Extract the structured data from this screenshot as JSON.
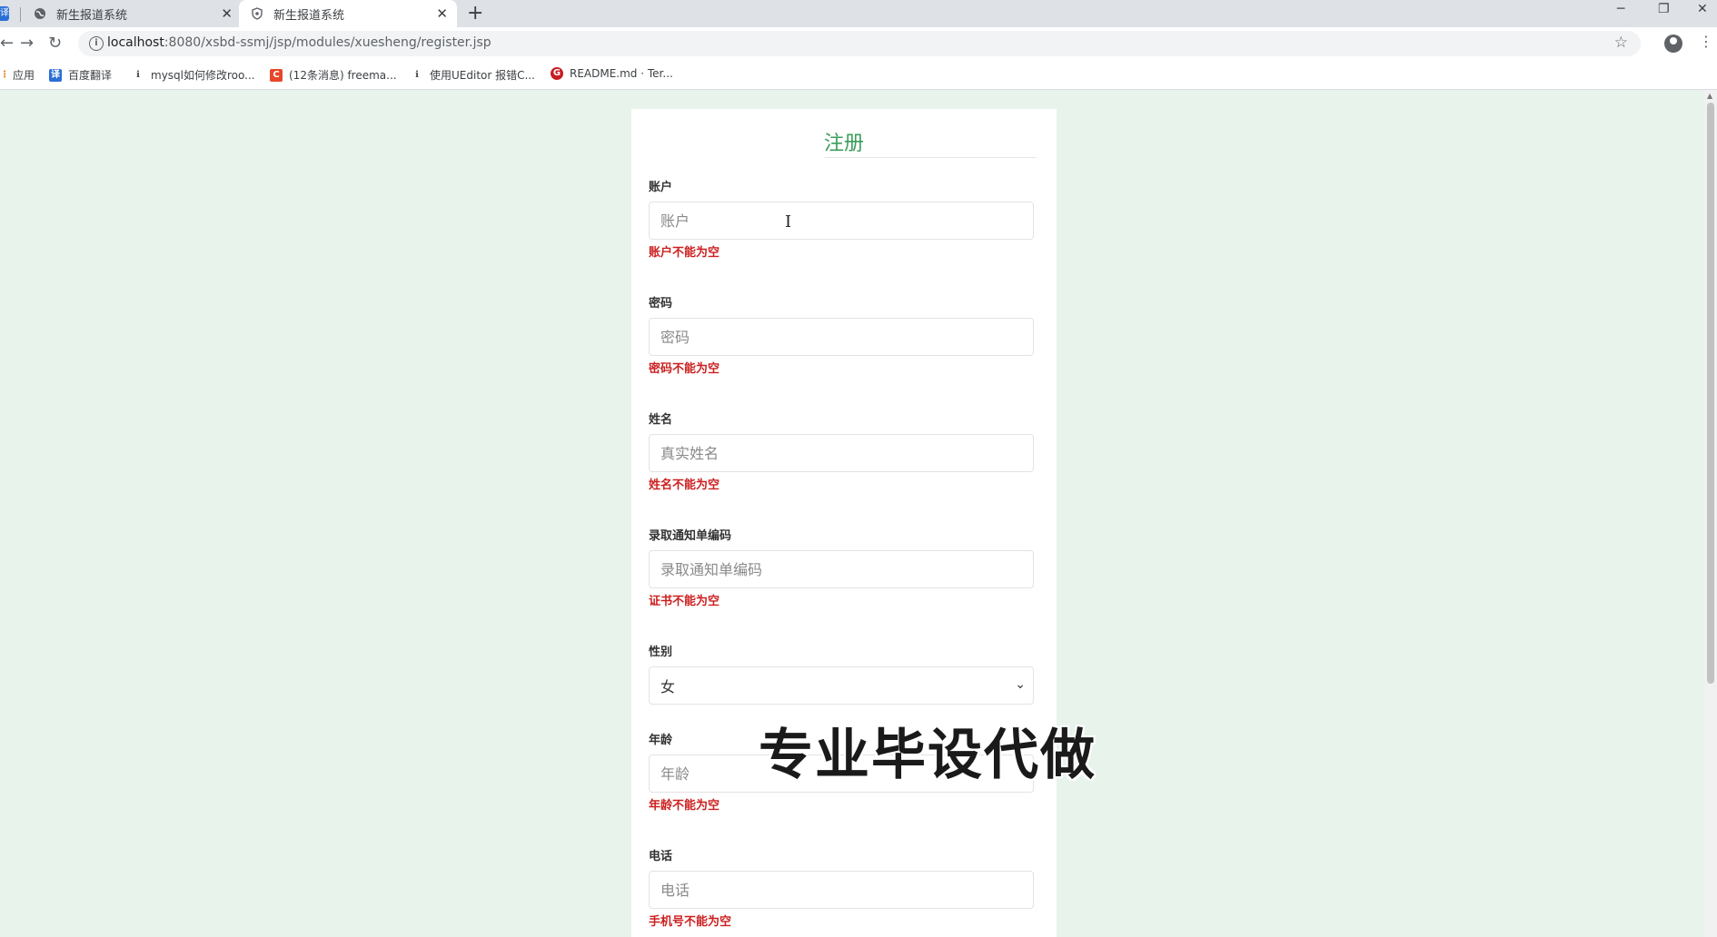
{
  "browser": {
    "tabs": [
      {
        "title": "新生报道系统",
        "active": false
      },
      {
        "title": "新生报道系统",
        "active": true
      }
    ],
    "url_host": "localhost",
    "url_rest": ":8080/xsbd-ssmj/jsp/modules/xuesheng/register.jsp",
    "bookmarks": [
      {
        "label": "应用",
        "icon": "apps-icon"
      },
      {
        "label": "百度翻译",
        "icon": "translate-icon"
      },
      {
        "label": "mysql如何修改roo...",
        "icon": "bookmark-page-icon"
      },
      {
        "label": "(12条消息) freema...",
        "icon": "csdn-icon"
      },
      {
        "label": "使用UEditor 报错C...",
        "icon": "bookmark-page-icon"
      },
      {
        "label": "README.md · Ter...",
        "icon": "gitee-icon"
      }
    ]
  },
  "form": {
    "title": "注册",
    "fields": [
      {
        "label": "账户",
        "placeholder": "账户",
        "error": "账户不能为空"
      },
      {
        "label": "密码",
        "placeholder": "密码",
        "error": "密码不能为空"
      },
      {
        "label": "姓名",
        "placeholder": "真实姓名",
        "error": "姓名不能为空"
      },
      {
        "label": "录取通知单编码",
        "placeholder": "录取通知单编码",
        "error": "证书不能为空"
      },
      {
        "label": "性别",
        "value": "女"
      },
      {
        "label": "年龄",
        "placeholder": "年龄",
        "error": "年龄不能为空"
      },
      {
        "label": "电话",
        "placeholder": "电话",
        "error": "手机号不能为空"
      }
    ]
  },
  "overlay": {
    "watermark": "专业毕设代做"
  },
  "colors": {
    "accent": "#3c9d5b",
    "error": "#cc1f1f",
    "page_bg": "#e8f3ec"
  }
}
